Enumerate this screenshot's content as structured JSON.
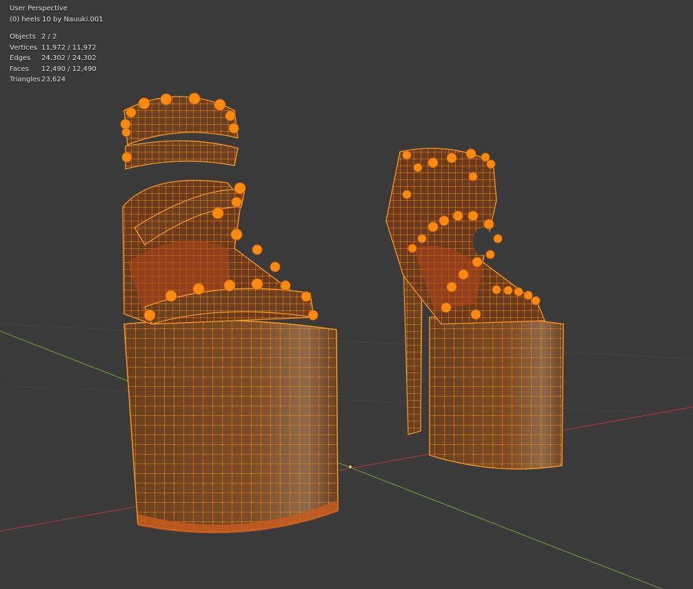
{
  "viewport": {
    "view_name": "User Perspective",
    "object_name": "(0) heels 10 by Nauuki.001",
    "stats": [
      {
        "label": "Objects",
        "value": "2 / 2"
      },
      {
        "label": "Vertices",
        "value": "11,972 / 11,972"
      },
      {
        "label": "Edges",
        "value": "24,302 / 24,302"
      },
      {
        "label": "Faces",
        "value": "12,490 / 12,490"
      },
      {
        "label": "Triangles",
        "value": "23,624"
      }
    ]
  },
  "colors": {
    "background": "#3a3a3a",
    "wire": "#ff9a1f",
    "mesh_fill": "#7a4a22",
    "x_axis": "#a33b42",
    "y_axis": "#6f9a32",
    "vertex_selected": "#ff8a10"
  },
  "icons": [
    "origin-dot-icon"
  ]
}
